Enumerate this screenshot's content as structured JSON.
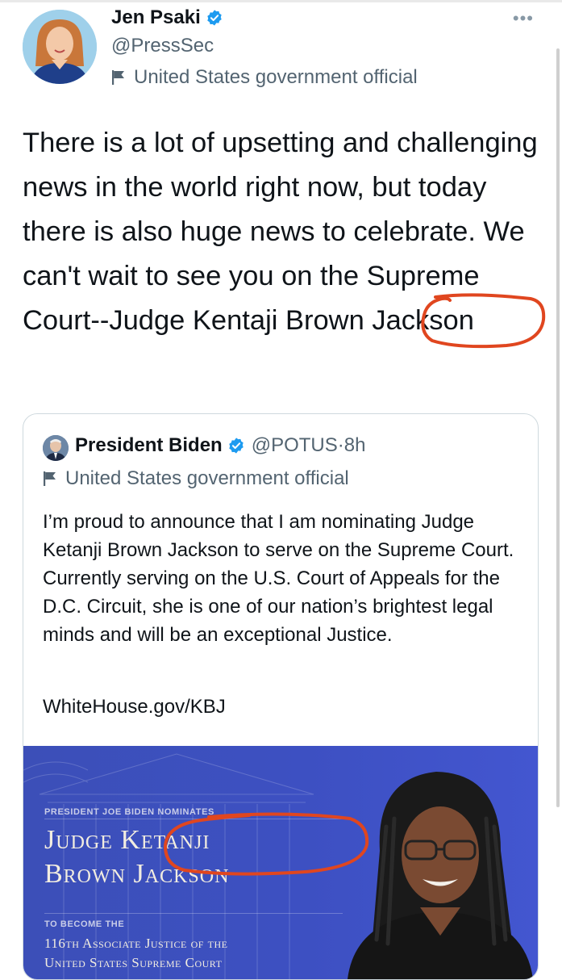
{
  "tweet": {
    "author_name": "Jen Psaki",
    "author_handle": "@PressSec",
    "gov_label": "United States government official",
    "more_label": "•••",
    "text": "There is a lot of upsetting and challenging news in the world right now, but today there is also huge news to celebrate.  We can't wait to see you on the Supreme Court--Judge Kentaji Brown Jackson"
  },
  "quoted": {
    "author_name": "President Biden",
    "author_handle": "@POTUS",
    "separator": "·",
    "time": "8h",
    "gov_label": "United States government official",
    "text": "I’m proud to announce that I am nominating Judge Ketanji Brown Jackson to serve on the Supreme Court. Currently serving on the U.S. Court of Appeals for the D.C. Circuit, she is one of our nation’s brightest legal minds and will be an exceptional Justice.",
    "link": "WhiteHouse.gov/KBJ"
  },
  "media": {
    "nominates": "PRESIDENT JOE BIDEN NOMINATES",
    "name_line1": "Judge Ketanji",
    "name_line2": "Brown Jackson",
    "to_become": "TO BECOME THE",
    "justice_line1": "116th Associate Justice of the",
    "justice_line2": "United States Supreme Court"
  },
  "colors": {
    "verified_blue": "#1d9bf0",
    "annotation_red": "#e0461f",
    "media_blue": "#3d50c2"
  },
  "icons": [
    "verified-badge-icon",
    "flag-icon",
    "more-icon"
  ]
}
